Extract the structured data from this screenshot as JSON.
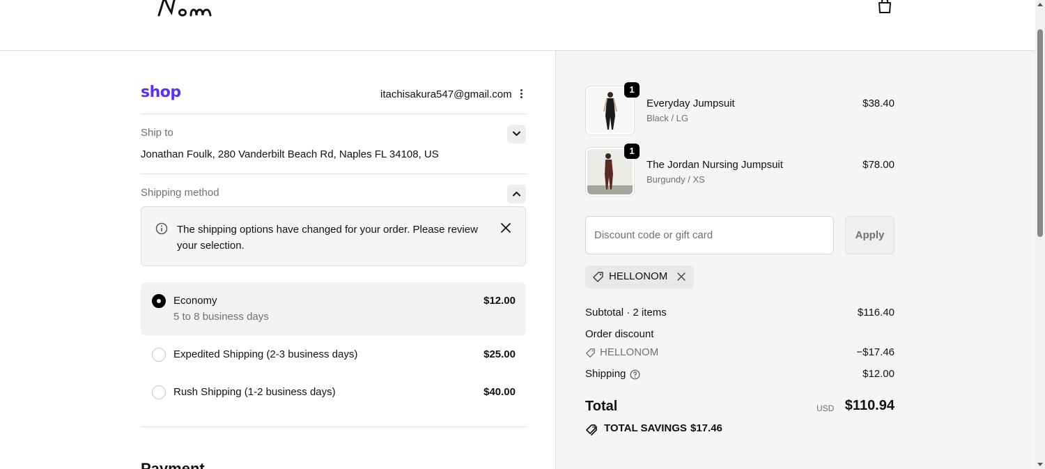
{
  "header": {
    "logo_icon": "nom-logo",
    "cart_icon": "shopping-bag-icon"
  },
  "account": {
    "shop_logo": "shop",
    "email": "itachisakura547@gmail.com"
  },
  "ship_to": {
    "label": "Ship to",
    "address": "Jonathan Foulk, 280 Vanderbilt Beach Rd, Naples FL 34108, US"
  },
  "shipping_method": {
    "label": "Shipping method",
    "notice": "The shipping options have changed for your order. Please review your selection.",
    "options": [
      {
        "name": "Economy",
        "detail": "5 to 8 business days",
        "price": "$12.00",
        "selected": true
      },
      {
        "name": "Expedited Shipping (2-3 business days)",
        "price": "$25.00",
        "selected": false
      },
      {
        "name": "Rush Shipping (1-2 business days)",
        "price": "$40.00",
        "selected": false
      }
    ]
  },
  "payment": {
    "heading": "Payment"
  },
  "cart": {
    "items": [
      {
        "name": "Everyday Jumpsuit",
        "variant": "Black / LG",
        "price": "$38.40",
        "qty": "1",
        "color": "#1a1a1a"
      },
      {
        "name": "The Jordan Nursing Jumpsuit",
        "variant": "Burgundy / XS",
        "price": "$78.00",
        "qty": "1",
        "color": "#5a2a22"
      }
    ]
  },
  "discount": {
    "placeholder": "Discount code or gift card",
    "apply_label": "Apply",
    "applied_code": "HELLONOM"
  },
  "summary": {
    "subtotal_label": "Subtotal · 2 items",
    "subtotal_value": "$116.40",
    "order_discount_label": "Order discount",
    "discount_code": "HELLONOM",
    "discount_value": "−$17.46",
    "shipping_label": "Shipping",
    "shipping_value": "$12.00",
    "total_label": "Total",
    "currency": "USD",
    "total_value": "$110.94",
    "savings_label": "TOTAL SAVINGS",
    "savings_value": "$17.46"
  }
}
